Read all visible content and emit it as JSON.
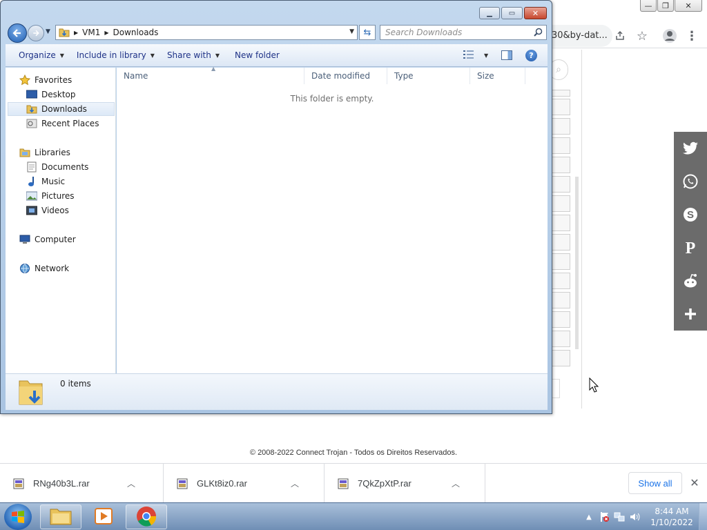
{
  "browser": {
    "address_tail": "30&by-dat...",
    "icons": [
      "share-icon",
      "star-icon",
      "profile-icon",
      "menu-icon"
    ],
    "social": [
      "twitter-icon",
      "whatsapp-icon",
      "skype-icon",
      "pinterest-icon",
      "reddit-icon",
      "plus-icon"
    ],
    "copyright": "© 2008-2022 Connect Trojan - Todos os Direitos Reservados."
  },
  "downloads": {
    "items": [
      {
        "name": "RNg40b3L.rar"
      },
      {
        "name": "GLKt8iz0.rar"
      },
      {
        "name": "7QkZpXtP.rar"
      }
    ],
    "show_all": "Show all"
  },
  "explorer": {
    "address": {
      "segments": [
        "VM1",
        "Downloads"
      ]
    },
    "search_placeholder": "Search Downloads",
    "toolbar": {
      "organize": "Organize",
      "include": "Include in library",
      "share": "Share with",
      "new_folder": "New folder"
    },
    "nav": {
      "favorites": "Favorites",
      "desktop": "Desktop",
      "downloads": "Downloads",
      "recent": "Recent Places",
      "libraries": "Libraries",
      "documents": "Documents",
      "music": "Music",
      "pictures": "Pictures",
      "videos": "Videos",
      "computer": "Computer",
      "network": "Network"
    },
    "columns": [
      "Name",
      "Date modified",
      "Type",
      "Size"
    ],
    "empty_message": "This folder is empty.",
    "details": {
      "count": "0 items"
    }
  },
  "taskbar": {
    "time": "8:44 AM",
    "date": "1/10/2022"
  },
  "colors": {
    "accent": "#1a73e8",
    "social_bar": "#6b6b6b",
    "taskbar": "#6f8eb5"
  }
}
